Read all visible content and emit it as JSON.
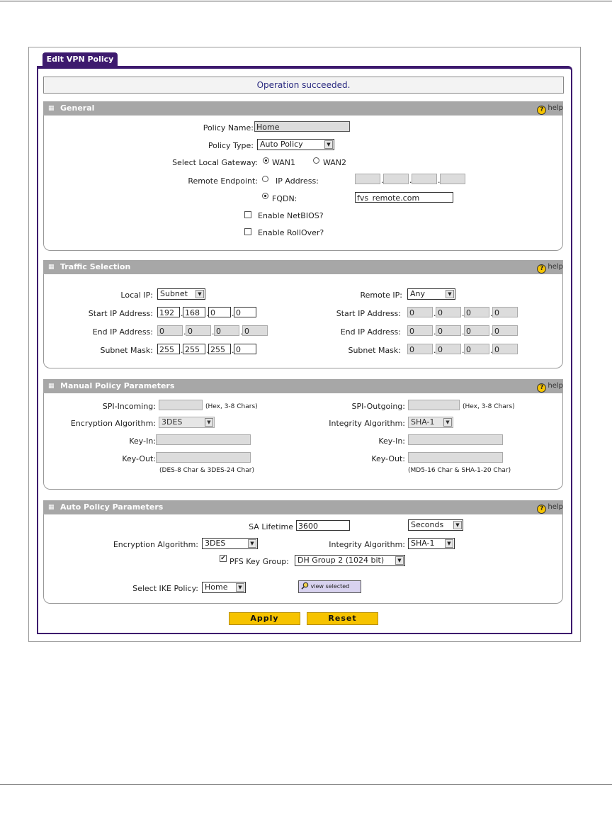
{
  "tab": {
    "label": "Edit VPN Policy"
  },
  "status_message": "Operation succeeded.",
  "help_label": "help",
  "general": {
    "title": "General",
    "policy_name_label": "Policy Name:",
    "policy_name_value": "Home",
    "policy_type_label": "Policy Type:",
    "policy_type_value": "Auto Policy",
    "local_gateway_label": "Select Local Gateway:",
    "wan1": "WAN1",
    "wan2": "WAN2",
    "remote_endpoint_label": "Remote Endpoint:",
    "ip_address_label": "IP Address:",
    "fqdn_label": "FQDN:",
    "fqdn_value": "fvs_remote.com",
    "netbios_label": "Enable NetBIOS?",
    "rollover_label": "Enable RollOver?"
  },
  "traffic": {
    "title": "Traffic Selection",
    "local_ip_label": "Local IP:",
    "local_ip_value": "Subnet",
    "remote_ip_label": "Remote IP:",
    "remote_ip_value": "Any",
    "start_ip_label": "Start IP Address:",
    "end_ip_label": "End IP Address:",
    "subnet_mask_label": "Subnet Mask:",
    "local_start": [
      "192",
      "168",
      "0",
      "0"
    ],
    "local_end": [
      "0",
      "0",
      "0",
      "0"
    ],
    "local_mask": [
      "255",
      "255",
      "255",
      "0"
    ],
    "remote_start": [
      "0",
      "0",
      "0",
      "0"
    ],
    "remote_end": [
      "0",
      "0",
      "0",
      "0"
    ],
    "remote_mask": [
      "0",
      "0",
      "0",
      "0"
    ]
  },
  "manual": {
    "title": "Manual Policy Parameters",
    "spi_in_label": "SPI-Incoming:",
    "spi_out_label": "SPI-Outgoing:",
    "spi_hint": "(Hex, 3-8 Chars)",
    "enc_label": "Encryption Algorithm:",
    "enc_value": "3DES",
    "int_label": "Integrity Algorithm:",
    "int_value": "SHA-1",
    "key_in_label": "Key-In:",
    "key_out_label": "Key-Out:",
    "enc_hint": "(DES-8 Char & 3DES-24 Char)",
    "int_hint": "(MD5-16 Char & SHA-1-20 Char)"
  },
  "auto": {
    "title": "Auto Policy Parameters",
    "sa_lifetime_label": "SA Lifetime",
    "sa_lifetime_value": "3600",
    "sa_unit": "Seconds",
    "enc_label": "Encryption Algorithm:",
    "enc_value": "3DES",
    "int_label": "Integrity Algorithm:",
    "int_value": "SHA-1",
    "pfs_label": "PFS Key Group:",
    "pfs_value": "DH Group 2 (1024 bit)",
    "ike_label": "Select IKE Policy:",
    "ike_value": "Home",
    "view_selected": "view selected"
  },
  "buttons": {
    "apply": "Apply",
    "reset": "Reset"
  }
}
